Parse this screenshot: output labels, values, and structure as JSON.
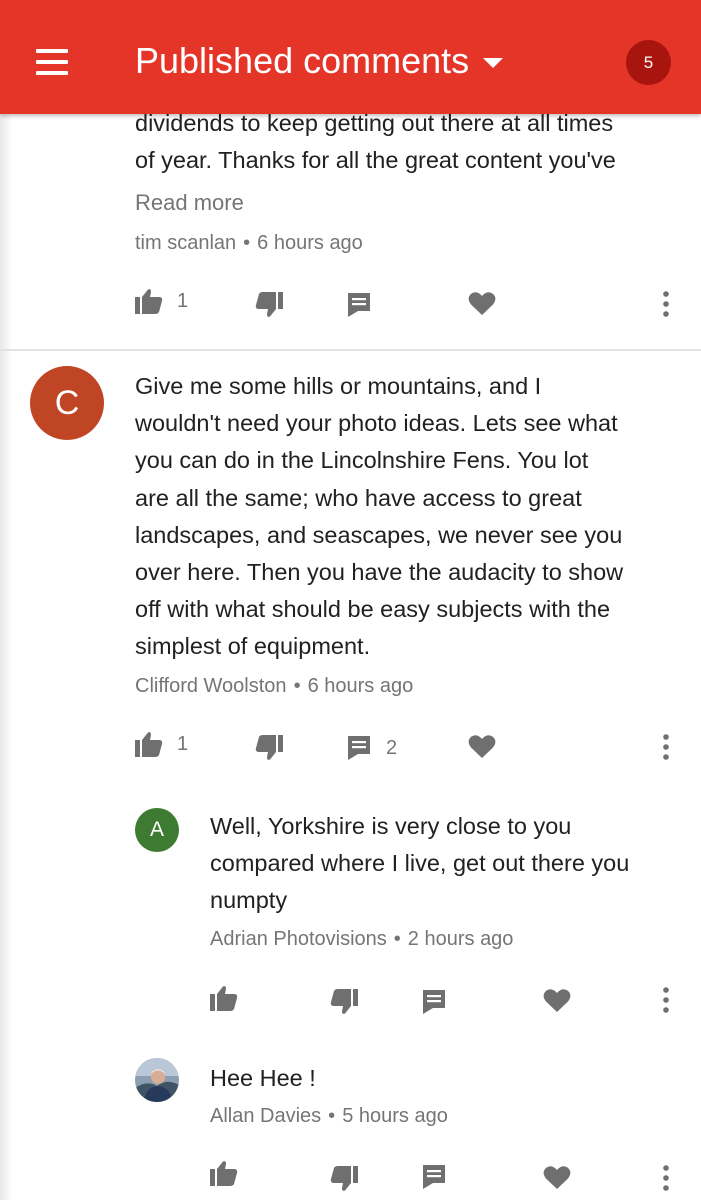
{
  "app_bar": {
    "title": "Published comments",
    "notification_count": "5",
    "bar_color": "#e53428",
    "badge_color": "#a8150f"
  },
  "icons": {
    "menu": "hamburger-menu-icon",
    "dropdown": "caret-down-icon",
    "like": "thumb-up-icon",
    "dislike": "thumb-down-icon",
    "reply": "comment-icon",
    "heart": "heart-icon",
    "more": "more-vert-icon"
  },
  "comments": [
    {
      "lines": [
        "dividends to keep getting out there at all times",
        "of year. Thanks for all the great content you've"
      ],
      "read_more": "Read more",
      "author": "tim scanlan",
      "time": "6 hours ago",
      "likes": "1"
    },
    {
      "avatar_letter": "C",
      "avatar_color": "#bf4524",
      "lines": [
        "Give me some hills or mountains, and I",
        "wouldn't need your photo ideas. Lets see what",
        "you can do in the Lincolnshire Fens. You lot",
        "are all the same; who have access to great",
        "landscapes, and seascapes, we never see you",
        "over here. Then you have the audacity to show",
        "off with what should be easy subjects with the",
        "simplest of equipment."
      ],
      "author": "Clifford Woolston",
      "time": "6 hours ago",
      "likes": "1",
      "replies": "2"
    }
  ],
  "replies": [
    {
      "avatar_letter": "A",
      "avatar_color": "#3d7a32",
      "lines": [
        "Well, Yorkshire is very close to you",
        "compared where I live, get out there you",
        "numpty"
      ],
      "author": "Adrian Photovisions",
      "time": "2 hours ago"
    },
    {
      "lines": [
        "Hee Hee !"
      ],
      "author": "Allan Davies",
      "time": "5 hours ago"
    }
  ],
  "separator": "•"
}
